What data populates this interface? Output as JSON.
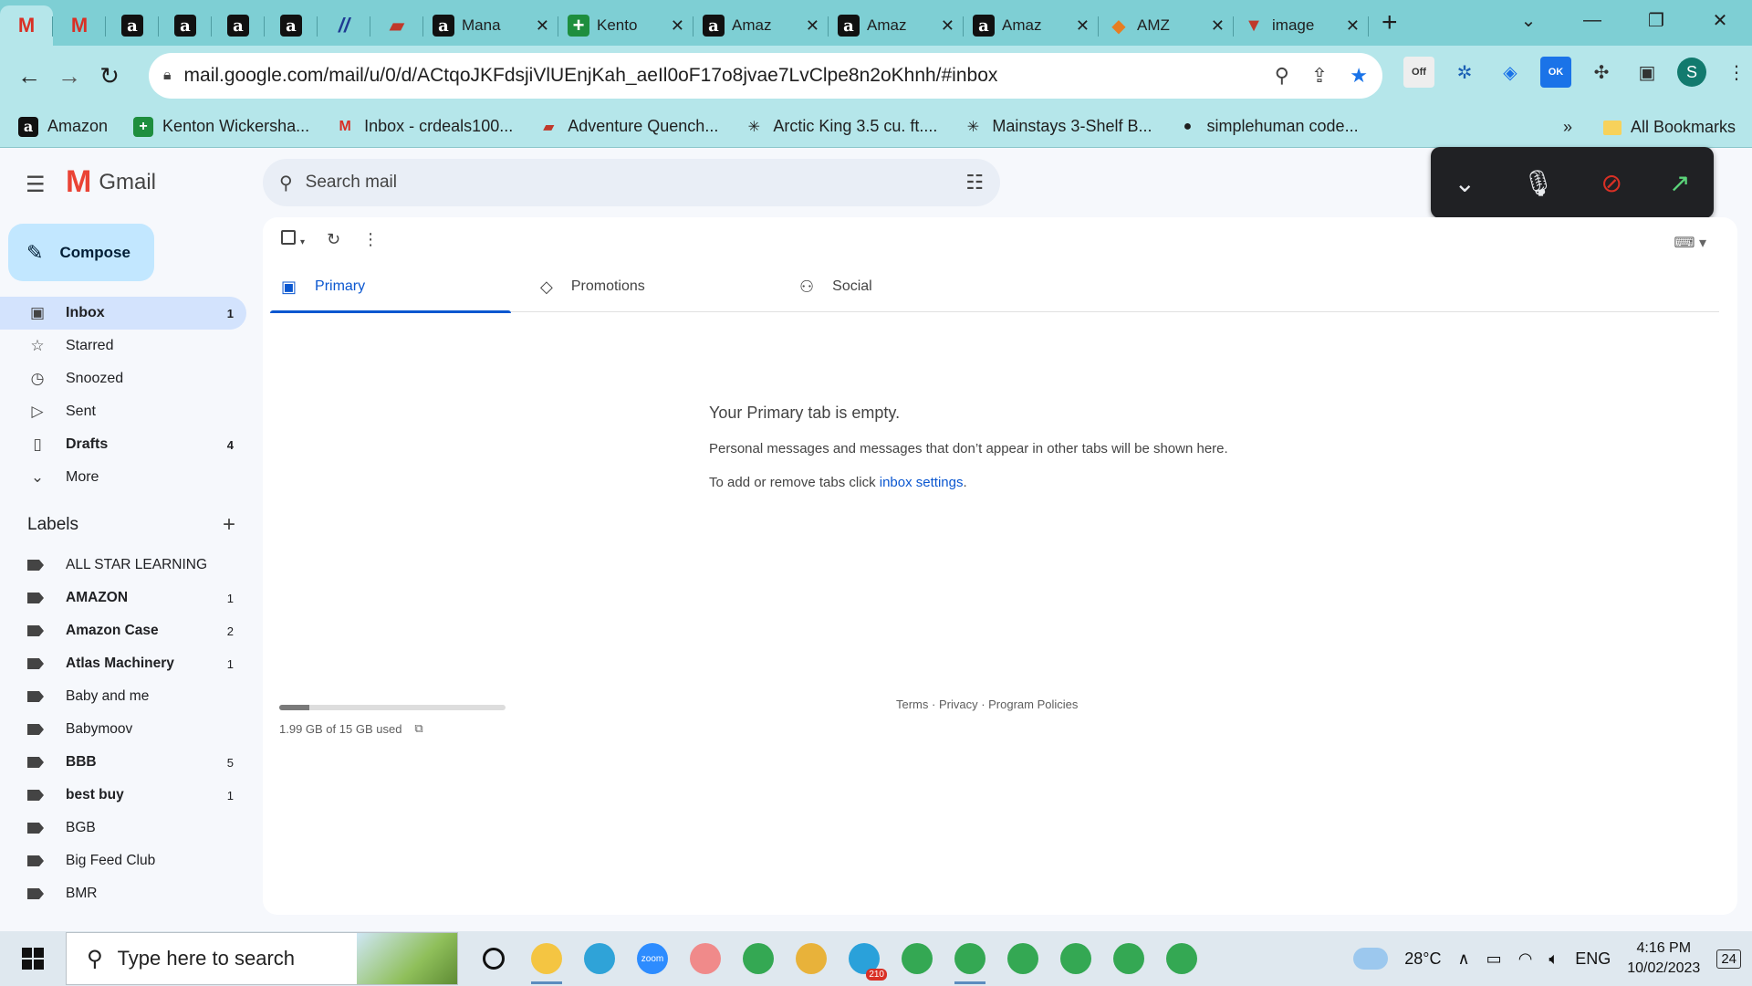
{
  "browser": {
    "tabs": [
      {
        "kind": "pinned",
        "icon": "gmail",
        "active": true
      },
      {
        "kind": "pinned",
        "icon": "gmail-alt"
      },
      {
        "kind": "pinned",
        "icon": "amazon"
      },
      {
        "kind": "pinned",
        "icon": "amazon"
      },
      {
        "kind": "pinned",
        "icon": "amazon"
      },
      {
        "kind": "pinned",
        "icon": "amazon"
      },
      {
        "kind": "pinned",
        "icon": "stripe"
      },
      {
        "kind": "pinned",
        "icon": "dark-logo"
      },
      {
        "kind": "normal",
        "icon": "amazon",
        "title": "Mana"
      },
      {
        "kind": "normal",
        "icon": "green-plus",
        "title": "Kento"
      },
      {
        "kind": "normal",
        "icon": "amazon",
        "title": "Amaz"
      },
      {
        "kind": "normal",
        "icon": "amazon",
        "title": "Amaz"
      },
      {
        "kind": "normal",
        "icon": "amazon",
        "title": "Amaz"
      },
      {
        "kind": "normal",
        "icon": "amz-v",
        "title": "AMZ"
      },
      {
        "kind": "normal",
        "icon": "image",
        "title": "image"
      }
    ],
    "url": "mail.google.com/mail/u/0/d/ACtqoJKFdsjiVlUEnjKah_aeIl0oF17o8jvae7LvClpe8n2oKhnh/#inbox",
    "bookmarks": [
      {
        "icon": "amazon",
        "label": "Amazon"
      },
      {
        "icon": "green-plus",
        "label": "Kenton Wickersha..."
      },
      {
        "icon": "gmail",
        "label": "Inbox - crdeals100..."
      },
      {
        "icon": "dark-logo",
        "label": "Adventure Quench..."
      },
      {
        "icon": "walmart",
        "label": "Arctic King 3.5 cu. ft...."
      },
      {
        "icon": "walmart",
        "label": "Mainstays 3-Shelf B..."
      },
      {
        "icon": "globe",
        "label": "simplehuman code..."
      }
    ],
    "bookmarks_overflow": "»",
    "all_bookmarks": "All Bookmarks",
    "profile_initial": "S",
    "ext_badges": {
      "off": "Off",
      "ok": "OK"
    }
  },
  "gmail": {
    "app_name": "Gmail",
    "search_placeholder": "Search mail",
    "compose_label": "Compose",
    "nav": [
      {
        "icon": "inbox-icon",
        "label": "Inbox",
        "count": "1",
        "active": true,
        "bold": true
      },
      {
        "icon": "star-icon",
        "label": "Starred",
        "count": ""
      },
      {
        "icon": "clock-icon",
        "label": "Snoozed",
        "count": ""
      },
      {
        "icon": "send-icon",
        "label": "Sent",
        "count": ""
      },
      {
        "icon": "draft-icon",
        "label": "Drafts",
        "count": "4",
        "bold": true
      },
      {
        "icon": "chevron-down-icon",
        "label": "More",
        "count": ""
      }
    ],
    "labels_title": "Labels",
    "labels": [
      {
        "label": "ALL STAR LEARNING",
        "count": "",
        "bold": false
      },
      {
        "label": "AMAZON",
        "count": "1",
        "bold": true
      },
      {
        "label": "Amazon Case",
        "count": "2",
        "bold": true
      },
      {
        "label": "Atlas Machinery",
        "count": "1",
        "bold": true
      },
      {
        "label": "Baby and me",
        "count": "",
        "bold": false
      },
      {
        "label": "Babymoov",
        "count": "",
        "bold": false
      },
      {
        "label": "BBB",
        "count": "5",
        "bold": true
      },
      {
        "label": "best buy",
        "count": "1",
        "bold": true
      },
      {
        "label": "BGB",
        "count": "",
        "bold": false
      },
      {
        "label": "Big Feed Club",
        "count": "",
        "bold": false
      },
      {
        "label": "BMR",
        "count": "",
        "bold": false
      }
    ],
    "tabs": [
      {
        "label": "Primary",
        "icon": "inbox-icon",
        "active": true
      },
      {
        "label": "Promotions",
        "icon": "tag-icon"
      },
      {
        "label": "Social",
        "icon": "people-icon"
      }
    ],
    "empty": {
      "heading": "Your Primary tab is empty.",
      "line1": "Personal messages and messages that don’t appear in other tabs will be shown here.",
      "line2_prefix": "To add or remove tabs click ",
      "line2_link": "inbox settings",
      "line2_suffix": "."
    },
    "storage": {
      "text": "1.99 GB of 15 GB used",
      "fraction": 0.133
    },
    "footer": {
      "terms": "Terms",
      "privacy": "Privacy",
      "policies": "Program Policies",
      "sep": " · "
    }
  },
  "taskbar": {
    "search_placeholder": "Type here to search",
    "apps": [
      {
        "name": "cortana",
        "color": "#ffffff"
      },
      {
        "name": "file-explorer",
        "color": "#f4c542",
        "running": true
      },
      {
        "name": "edge",
        "color": "#2fa3d8"
      },
      {
        "name": "zoom",
        "color": "#2d8cff",
        "label": "zoom"
      },
      {
        "name": "snip",
        "color": "#f08a8a"
      },
      {
        "name": "chrome-1",
        "color": "#34a853"
      },
      {
        "name": "slack",
        "color": "#e8b23a"
      },
      {
        "name": "telegram",
        "color": "#2aa1da",
        "badge": "210"
      },
      {
        "name": "chrome-2",
        "color": "#34a853"
      },
      {
        "name": "chrome-3",
        "color": "#34a853",
        "running": true
      },
      {
        "name": "chrome-4",
        "color": "#34a853"
      },
      {
        "name": "chrome-5",
        "color": "#34a853"
      },
      {
        "name": "chrome-6",
        "color": "#34a853"
      },
      {
        "name": "chrome-7",
        "color": "#34a853"
      }
    ],
    "temperature": "28°C",
    "language": "ENG",
    "time": "4:16 PM",
    "date": "10/02/2023",
    "notifications": "24"
  }
}
